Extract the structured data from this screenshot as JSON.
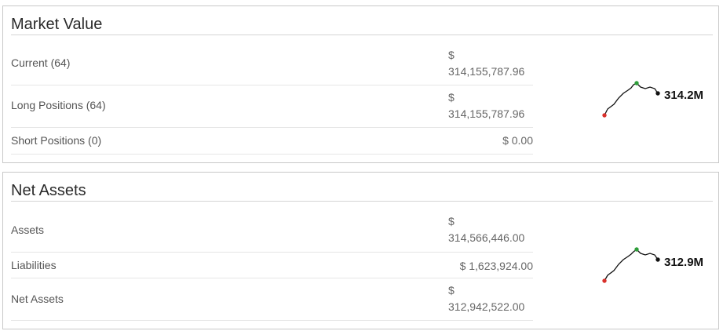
{
  "market_value": {
    "title": "Market Value",
    "rows": [
      {
        "label": "Current (64)",
        "value": "$ 314,155,787.96"
      },
      {
        "label": "Long Positions (64)",
        "value": "$ 314,155,787.96"
      },
      {
        "label": "Short Positions (0)",
        "value": "$ 0.00"
      }
    ],
    "sparkline": {
      "label": "314.2M"
    }
  },
  "net_assets": {
    "title": "Net Assets",
    "rows": [
      {
        "label": "Assets",
        "value": "$ 314,566,446.00"
      },
      {
        "label": "Liabilities",
        "value": "$ 1,623,924.00"
      },
      {
        "label": "Net Assets",
        "value": "$ 312,942,522.00"
      }
    ],
    "sparkline": {
      "label": "312.9M"
    }
  },
  "colors": {
    "spark_line": "#111111",
    "spark_min": "#d9302b",
    "spark_max": "#2e9e3a",
    "spark_last": "#111111"
  }
}
